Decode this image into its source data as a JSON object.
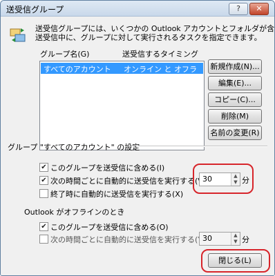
{
  "window": {
    "title": "送受信グループ",
    "help_label": "?",
    "close_label": "✕"
  },
  "description": {
    "line1": "送受信グループには、いくつかの Outlook アカウントとフォルダが含まれます。",
    "line2": "送受信中に、グループに対して実行されるタスクを指定できます。"
  },
  "list": {
    "col_name": "グループ名(G)",
    "col_timing": "送受信するタイミング",
    "rows": [
      {
        "name": "すべてのアカウント",
        "timing": "オンライン と オフライン"
      }
    ]
  },
  "buttons": {
    "new": "新規作成(N)...",
    "edit": "編集(E)...",
    "copy": "コピー(C)...",
    "delete": "削除(M)",
    "rename": "名前の変更(R)",
    "close": "閉じる(L)"
  },
  "settings": {
    "heading": "グループ \"すべてのアカウント\" の設定",
    "online": {
      "include_label": "このグループを送受信に含める(I)",
      "include_checked": true,
      "schedule_label": "次の時間ごとに自動的に送受信を実行する(V)",
      "schedule_checked": true,
      "interval_value": "30",
      "unit": "分",
      "on_exit_label": "終了時に自動的に送受信を実行する(X)",
      "on_exit_checked": false
    },
    "offline_heading": "Outlook がオフラインのとき",
    "offline": {
      "include_label": "このグループを送受信に含める(O)",
      "include_checked": true,
      "schedule_label": "次の時間ごとに自動的に送受信を実行する(Y)",
      "schedule_checked": false,
      "interval_value": "30",
      "unit": "分"
    }
  },
  "colors": {
    "selection": "#3399ff",
    "highlight_outline": "#d7242a"
  }
}
